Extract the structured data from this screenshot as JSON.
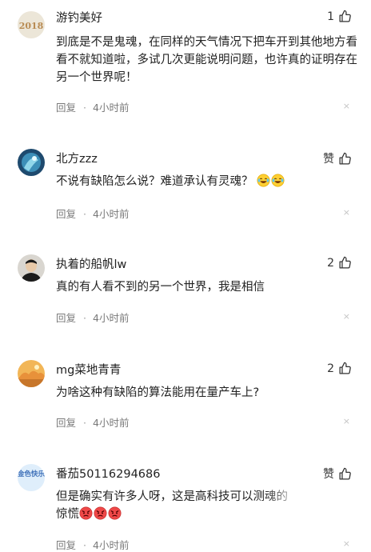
{
  "comments": [
    {
      "username": "游钓美好",
      "likes": "1",
      "avatar_label": "2018",
      "text": "到底是不是鬼魂，在同样的天气情况下把车开到其他地方看看不就知道啦，多试几次更能说明问题，也许真的证明存在另一个世界呢！",
      "reply_label": "回复",
      "time": "4小时前",
      "close": "×"
    },
    {
      "username": "北方zzz",
      "likes": "赞",
      "text": "不说有缺陷怎么说？难道承认有灵魂？",
      "reply_label": "回复",
      "time": "4小时前",
      "close": "×"
    },
    {
      "username": "执着的船帆lw",
      "likes": "2",
      "text": "真的有人看不到的另一个世界，我是相信",
      "reply_label": "回复",
      "time": "4小时前",
      "close": "×"
    },
    {
      "username": "mg菜地青青",
      "likes": "2",
      "text": "为啥这种有缺陷的算法能用在量产车上?",
      "reply_label": "回复",
      "time": "4小时前",
      "close": "×"
    },
    {
      "username": "番茄50116294686",
      "likes": "赞",
      "avatar_label": "金色快乐",
      "text": "但是确实有许多人呀，这是高科技可以测魂的",
      "text_line2": "惊慌",
      "reply_label": "回复",
      "time": "4小时前",
      "close": "×"
    }
  ],
  "colors": {
    "text": "#222222",
    "meta": "#7a7a7a",
    "close": "#c4c4c4"
  }
}
